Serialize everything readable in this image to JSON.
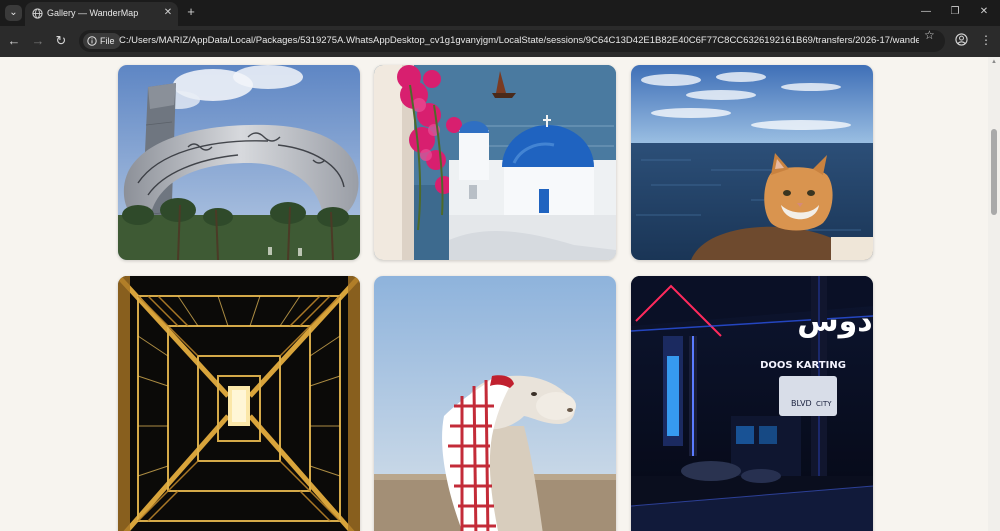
{
  "browser": {
    "tab_title": "Gallery — WanderMap",
    "site_chip_label": "File",
    "url": "C:/Users/MARIZ/AppData/Local/Packages/5319275A.WhatsAppDesktop_cv1g1gvanyjgm/LocalState/sessions/9C64C13D42E1B82E40C6F77C8CC6326192161B69/transfers/2026-17/wandermap_M's/...",
    "icons": {
      "tab_search": "chevron-down-icon",
      "favicon": "globe-icon",
      "close": "close-icon",
      "new_tab": "plus-icon",
      "back": "arrow-left-icon",
      "forward": "arrow-right-icon",
      "reload": "reload-icon",
      "info": "info-icon",
      "bookmark": "star-icon",
      "profile": "profile-icon",
      "menu": "kebab-menu-icon",
      "minimize": "minimize-icon",
      "restore": "restore-icon",
      "window_close": "close-icon"
    },
    "glyphs": {
      "tab_search": "⌄",
      "close": "✕",
      "new_tab": "+",
      "back": "←",
      "forward": "→",
      "reload": "↻",
      "bookmark": "☆",
      "menu": "⋮",
      "minimize": "—",
      "restore": "❐",
      "window_close": "✕",
      "scroll_up": "▲"
    }
  },
  "gallery": {
    "photos": [
      {
        "subject": "museum-of-the-future-photo"
      },
      {
        "subject": "santorini-blue-dome-photo"
      },
      {
        "subject": "cat-by-the-sea-photo"
      },
      {
        "subject": "eiffel-tower-underside-photo"
      },
      {
        "subject": "camel-with-keffiyeh-photo"
      },
      {
        "subject": "doos-karting-neon-photo"
      }
    ],
    "photo_texts": {
      "neon_sign_arabic": "دوس",
      "neon_sign_latin": "DOOS KARTING",
      "street_sign_latin": "BLVD",
      "street_sign_latin_2": "CITY"
    }
  },
  "colors": {
    "page_background": "#f7f4ef",
    "chrome_dark": "#1f1f1f",
    "toolbar": "#2b2b2b"
  }
}
